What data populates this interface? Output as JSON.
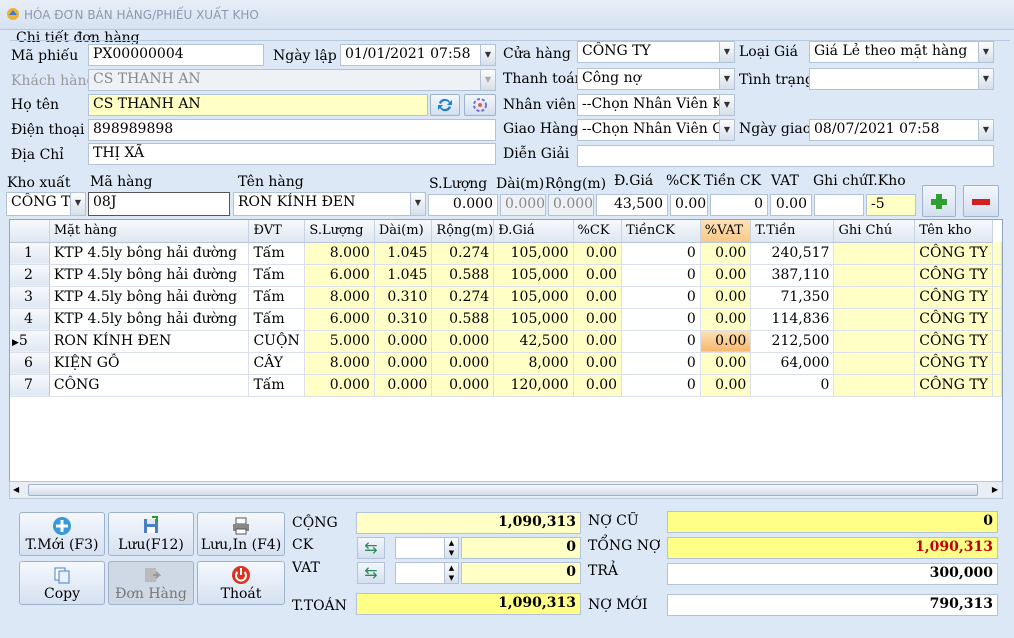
{
  "window": {
    "title": "HÓA ĐƠN BÁN HÀNG/PHIẾU XUẤT KHO"
  },
  "section": {
    "title": "Chi tiết đơn hàng"
  },
  "form": {
    "ma_phieu_label": "Mã phiếu",
    "ma_phieu": "PX00000004",
    "ngay_lap_label": "Ngày lập",
    "ngay_lap": "01/01/2021  07:58",
    "cua_hang_label": "Cửa hàng",
    "cua_hang": "CÔNG TY",
    "loai_gia_label": "Loại Giá",
    "loai_gia": "Giá Lẻ theo mặt hàng",
    "khach_hang_label": "Khách hàng",
    "khach_hang": "CS THANH AN",
    "thanh_toan_label": "Thanh toán",
    "thanh_toan": "Công nợ",
    "tinh_trang_label": "Tình trạng",
    "tinh_trang": "",
    "ho_ten_label": "Họ tên",
    "ho_ten": "CS THANH AN",
    "nhan_vien_label": "Nhân viên",
    "nhan_vien": "--Chọn Nhân Viên Kin",
    "dien_thoai_label": "Điện thoại",
    "dien_thoai": "898989898",
    "giao_hang_label": "Giao Hàng",
    "giao_hang": "--Chọn Nhân Viên Gia",
    "ngay_giao_label": "Ngày giao",
    "ngay_giao": "08/07/2021  07:58",
    "dia_chi_label": "Địa Chỉ",
    "dia_chi": "THỊ XÃ",
    "dien_giai_label": "Diễn Giải",
    "dien_giai": ""
  },
  "entry": {
    "labels": {
      "kho_xuat": "Kho xuất",
      "ma_hang": "Mã hàng",
      "ten_hang": "Tên hàng",
      "so_luong": "S.Lượng",
      "dai": "Dài(m)",
      "rong": "Rộng(m)",
      "don_gia": "Đ.Giá",
      "ck": "%CK",
      "tien_ck": "Tiền CK",
      "vat": "VAT",
      "ghi_chu": "Ghi chú",
      "t_kho": "T.Kho"
    },
    "kho_xuat": "CÔNG T",
    "ma_hang": "08J",
    "ten_hang": "RON KÍNH ĐEN",
    "so_luong": "0.000",
    "dai": "0.000",
    "rong": "0.000",
    "don_gia": "43,500",
    "ck": "0.00",
    "tien_ck": "0",
    "vat": "0.00",
    "ghi_chu": "",
    "t_kho": "-5"
  },
  "grid": {
    "columns": [
      "Mặt hàng",
      "ĐVT",
      "S.Lượng",
      "Dài(m)",
      "Rộng(m)",
      "Đ.Giá",
      "%CK",
      "TiềnCK",
      "%VAT",
      "T.Tiền",
      "Ghi Chú",
      "Tên kho"
    ],
    "rows": [
      {
        "no": "1",
        "mat_hang": "KTP 4.5ly bông hải đường",
        "dvt": "Tấm",
        "sl": "8.000",
        "dai": "1.045",
        "rong": "0.274",
        "gia": "105,000",
        "ck": "0.00",
        "tienck": "0",
        "vat": "0.00",
        "tien": "240,517",
        "ghichu": "",
        "kho": "CÔNG TY"
      },
      {
        "no": "2",
        "mat_hang": "KTP 4.5ly bông hải đường",
        "dvt": "Tấm",
        "sl": "6.000",
        "dai": "1.045",
        "rong": "0.588",
        "gia": "105,000",
        "ck": "0.00",
        "tienck": "0",
        "vat": "0.00",
        "tien": "387,110",
        "ghichu": "",
        "kho": "CÔNG TY"
      },
      {
        "no": "3",
        "mat_hang": "KTP 4.5ly bông hải đường",
        "dvt": "Tấm",
        "sl": "8.000",
        "dai": "0.310",
        "rong": "0.274",
        "gia": "105,000",
        "ck": "0.00",
        "tienck": "0",
        "vat": "0.00",
        "tien": "71,350",
        "ghichu": "",
        "kho": "CÔNG TY"
      },
      {
        "no": "4",
        "mat_hang": "KTP 4.5ly bông hải đường",
        "dvt": "Tấm",
        "sl": "6.000",
        "dai": "0.310",
        "rong": "0.588",
        "gia": "105,000",
        "ck": "0.00",
        "tienck": "0",
        "vat": "0.00",
        "tien": "114,836",
        "ghichu": "",
        "kho": "CÔNG TY"
      },
      {
        "no": "5",
        "mat_hang": "RON KÍNH ĐEN",
        "dvt": "CUỘN",
        "sl": "5.000",
        "dai": "0.000",
        "rong": "0.000",
        "gia": "42,500",
        "ck": "0.00",
        "tienck": "0",
        "vat": "0.00",
        "tien": "212,500",
        "ghichu": "",
        "kho": "CÔNG TY",
        "selected": true
      },
      {
        "no": "6",
        "mat_hang": "KIỆN GỖ",
        "dvt": "CÂY",
        "sl": "8.000",
        "dai": "0.000",
        "rong": "0.000",
        "gia": "8,000",
        "ck": "0.00",
        "tienck": "0",
        "vat": "0.00",
        "tien": "64,000",
        "ghichu": "",
        "kho": "CÔNG TY"
      },
      {
        "no": "7",
        "mat_hang": "CÔNG",
        "dvt": "Tấm",
        "sl": "0.000",
        "dai": "0.000",
        "rong": "0.000",
        "gia": "120,000",
        "ck": "0.00",
        "tienck": "0",
        "vat": "0.00",
        "tien": "0",
        "ghichu": "",
        "kho": "CÔNG TY"
      }
    ]
  },
  "buttons": {
    "new": "T.Mới (F3)",
    "save": "Lưu(F12)",
    "save_print": "Lưu,In (F4)",
    "copy": "Copy",
    "order": "Đơn Hàng",
    "exit": "Thoát"
  },
  "totals": {
    "cong_label": "CỘNG",
    "cong": "1,090,313",
    "ck_label": "CK",
    "ck_pct": "",
    "ck": "0",
    "vat_label": "VAT",
    "vat_pct": "",
    "vat": "0",
    "t_toan_label": "T.TOÁN",
    "t_toan": "1,090,313",
    "no_cu_label": "NỢ CŨ",
    "no_cu": "0",
    "tong_no_label": "TỔNG NỢ",
    "tong_no": "1,090,313",
    "tra_label": "TRẢ",
    "tra": "300,000",
    "no_moi_label": "NỢ MỚI",
    "no_moi": "790,313"
  },
  "colors": {
    "highlight_yellow": "#ffffc6",
    "panel_blue": "#dce8f6",
    "total_red": "#c00000"
  }
}
